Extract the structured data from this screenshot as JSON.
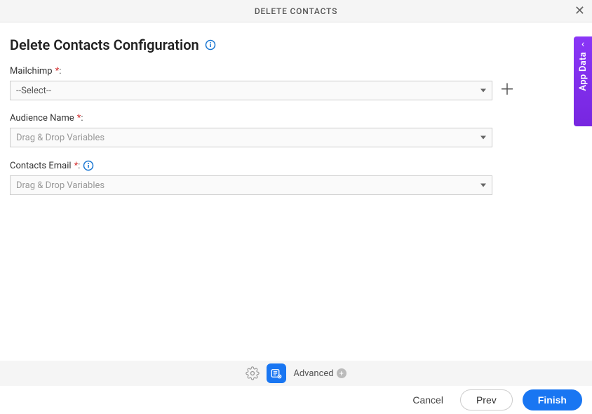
{
  "header": {
    "title": "DELETE CONTACTS"
  },
  "page": {
    "title": "Delete Contacts Configuration"
  },
  "fields": {
    "mailchimp": {
      "label": "Mailchimp",
      "value": "--Select--"
    },
    "audience": {
      "label": "Audience Name",
      "placeholder": "Drag & Drop Variables"
    },
    "email": {
      "label": "Contacts Email",
      "placeholder": "Drag & Drop Variables"
    }
  },
  "sideTab": {
    "label": "App Data"
  },
  "bottomBar": {
    "advanced": "Advanced"
  },
  "footer": {
    "cancel": "Cancel",
    "prev": "Prev",
    "finish": "Finish"
  },
  "symbols": {
    "required": "*",
    "colon": ":"
  }
}
